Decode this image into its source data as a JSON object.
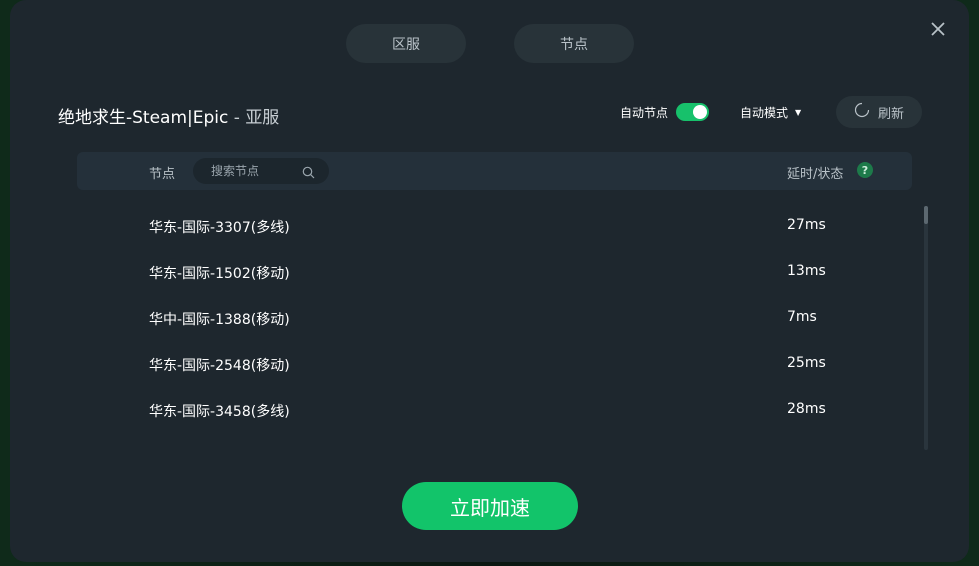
{
  "tabs": {
    "region": "区服",
    "node": "节点"
  },
  "game": {
    "name": "绝地求生-Steam|Epic",
    "separator": "-",
    "region": "亚服"
  },
  "controls": {
    "auto_node_label": "自动节点",
    "auto_node_on": true,
    "mode_label": "自动模式",
    "refresh_label": "刷新"
  },
  "table": {
    "col_node": "节点",
    "search_placeholder": "搜索节点",
    "col_latency": "延时/状态",
    "help": "?",
    "rows": [
      {
        "name": "华东-国际-3307(多线)",
        "latency": "27ms"
      },
      {
        "name": "华东-国际-1502(移动)",
        "latency": "13ms"
      },
      {
        "name": "华中-国际-1388(移动)",
        "latency": "7ms"
      },
      {
        "name": "华东-国际-2548(移动)",
        "latency": "25ms"
      },
      {
        "name": "华东-国际-3458(多线)",
        "latency": "28ms"
      }
    ]
  },
  "cta_label": "立即加速",
  "colors": {
    "accent": "#12c46a",
    "dialog_bg": "#1e272e"
  },
  "icons": {
    "close": "close-icon",
    "search": "search-icon",
    "refresh": "refresh-icon",
    "help": "help-icon",
    "caret": "caret-down-icon"
  }
}
